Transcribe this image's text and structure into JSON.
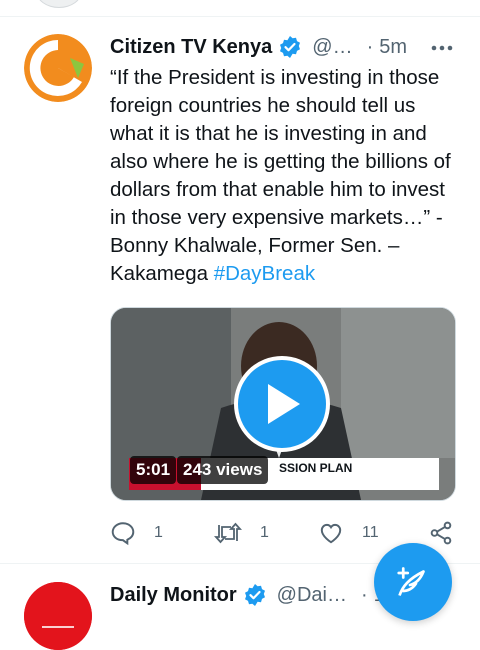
{
  "tweets": [
    {
      "author_name": "Citizen TV Kenya",
      "handle": "@…",
      "separator": "·",
      "time": "5m",
      "text_before_hashtag": "“If the President is investing in those foreign countries he should tell us what it is that he is investing in and also where he is getting the billions of dollars from that enable him to invest in those very expensive markets…” - Bonny Khalwale, Former Sen. – Kakamega ",
      "hashtag": "#DayBreak",
      "media": {
        "duration": "5:01",
        "views": "243 views",
        "banner_text": "SSION PLAN"
      },
      "actions": {
        "replies": "1",
        "retweets": "1",
        "likes": "11"
      },
      "avatar_colors": {
        "ring": "#f28c1e",
        "accent": "#8cc63f"
      }
    },
    {
      "author_name": "Daily Monitor",
      "handle": "@Dai…",
      "separator": "·",
      "time": "1",
      "avatar_colors": {
        "bg": "#e3141c"
      }
    }
  ],
  "colors": {
    "accent": "#1d9bf0",
    "text": "#0f1419",
    "muted": "#536471"
  },
  "icons": [
    "verified-badge-icon",
    "more-icon",
    "play-icon",
    "reply-icon",
    "retweet-icon",
    "like-icon",
    "share-icon",
    "compose-icon"
  ]
}
